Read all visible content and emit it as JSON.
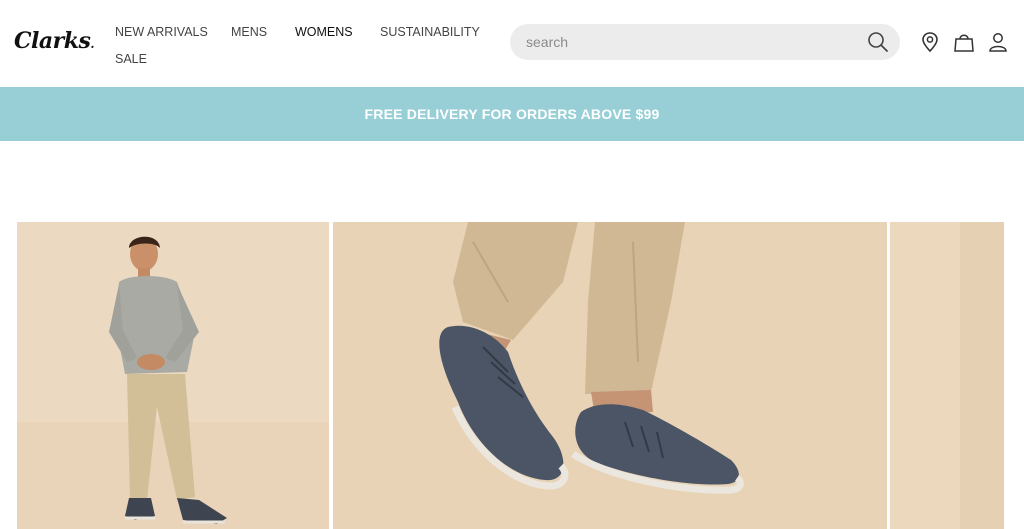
{
  "brand": {
    "logo_text": "Clarks"
  },
  "nav": {
    "items": [
      {
        "label": "NEW ARRIVALS"
      },
      {
        "label": "MENS"
      },
      {
        "label": "WOMENS"
      },
      {
        "label": "SUSTAINABILITY"
      },
      {
        "label": "SALE"
      }
    ]
  },
  "search": {
    "placeholder": "search",
    "value": "",
    "icon": "search-icon"
  },
  "header_icons": [
    "location-pin-icon",
    "shopping-bag-icon",
    "user-account-icon"
  ],
  "promo": {
    "text": "FREE DELIVERY FOR ORDERS ABOVE $99",
    "background": "#98cfd6"
  },
  "gallery": {
    "panels": [
      {
        "alt": "man-in-grey-sweater-and-beige-chinos"
      },
      {
        "alt": "close-up-navy-sneakers"
      },
      {
        "alt": "partial-next-image"
      }
    ]
  },
  "colors": {
    "accent": "#98cfd6",
    "text": "#222222",
    "search_bg": "#ececec"
  }
}
